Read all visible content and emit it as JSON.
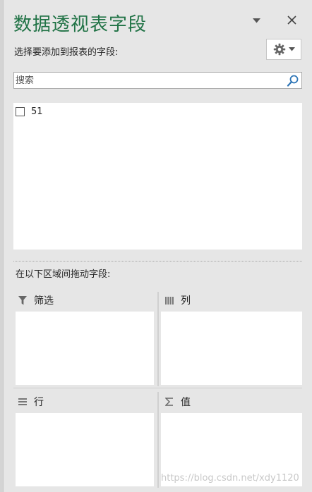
{
  "panel": {
    "title": "数据透视表字段",
    "subtitle": "选择要添加到报表的字段:",
    "search_placeholder": "搜索"
  },
  "fields": [
    {
      "label": "51",
      "checked": false
    }
  ],
  "areas": {
    "instruction": "在以下区域间拖动字段:",
    "filter": {
      "label": "筛选",
      "icon": "filter-icon"
    },
    "columns": {
      "label": "列",
      "icon": "columns-icon"
    },
    "rows": {
      "label": "行",
      "icon": "rows-icon"
    },
    "values": {
      "label": "值",
      "icon": "sigma-icon"
    }
  },
  "watermark": "https://blog.csdn.net/xdy1120",
  "colors": {
    "title": "#217346",
    "background": "#e6e6e6",
    "search_icon": "#2e75b6"
  }
}
